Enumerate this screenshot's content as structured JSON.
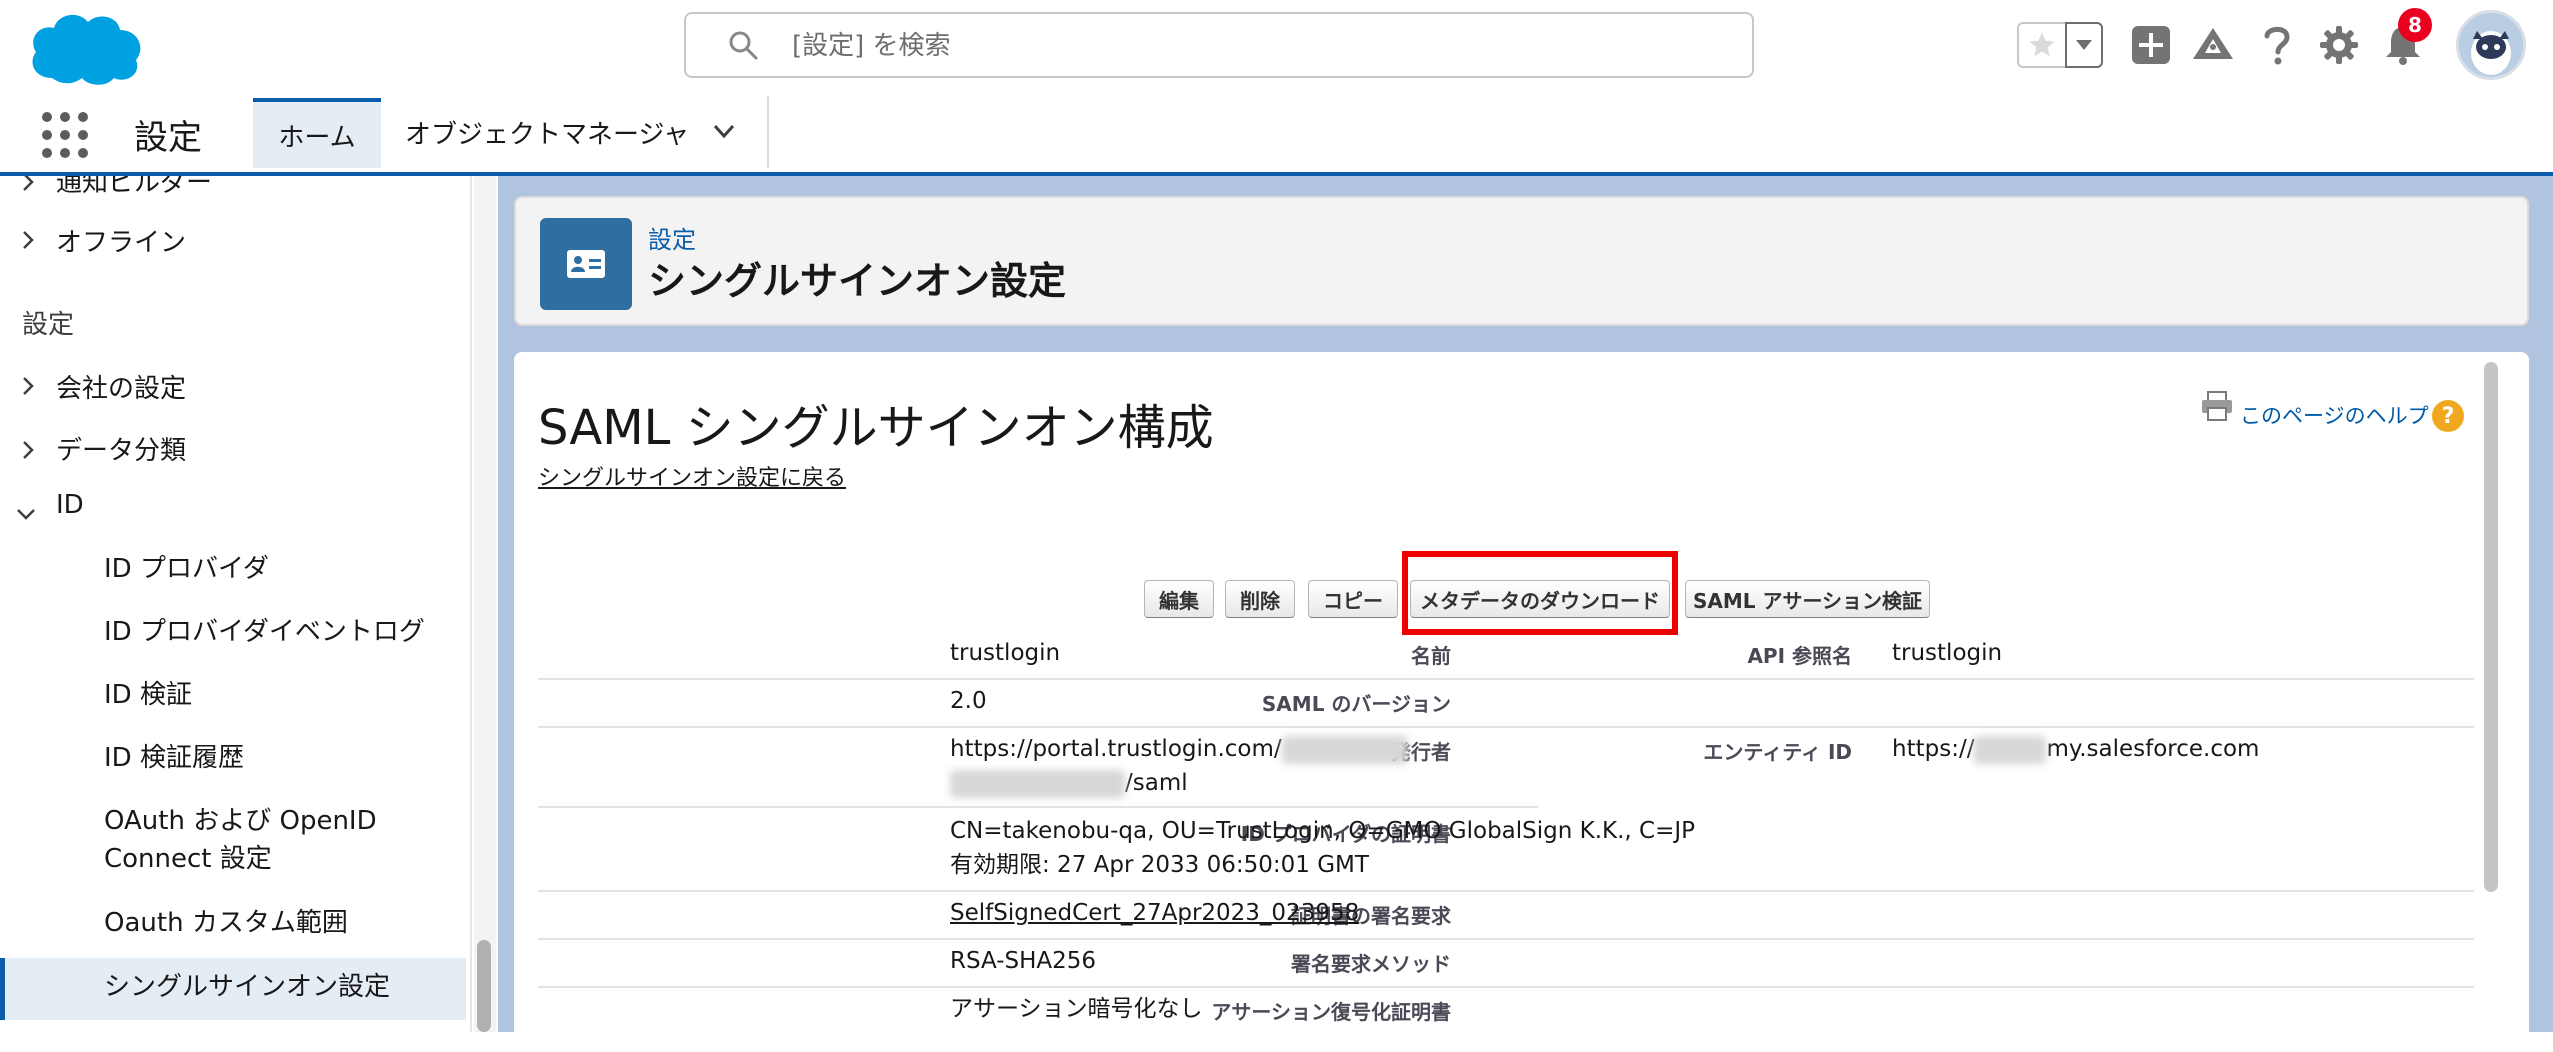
{
  "header": {
    "search_placeholder": "[設定] を検索",
    "notification_count": "8"
  },
  "app_nav": {
    "app_name": "設定",
    "tabs": [
      {
        "label": "ホーム"
      },
      {
        "label": "オブジェクトマネージャ"
      }
    ]
  },
  "sidebar": {
    "items": [
      {
        "label": "通知ビルダー"
      },
      {
        "label": "オフライン"
      }
    ],
    "section_label": "設定",
    "groups": [
      {
        "label": "会社の設定"
      },
      {
        "label": "データ分類"
      },
      {
        "label": "ID"
      }
    ],
    "id_children": [
      {
        "label": "ID プロバイダ"
      },
      {
        "label": "ID プロバイダイベントログ"
      },
      {
        "label": "ID 検証"
      },
      {
        "label": "ID 検証履歴"
      },
      {
        "label": "OAuth および OpenID"
      },
      {
        "label": "Connect 設定"
      },
      {
        "label": "Oauth カスタム範囲"
      },
      {
        "label": "シングルサインオン設定"
      }
    ]
  },
  "page_header": {
    "eyebrow": "設定",
    "title": "シングルサインオン設定"
  },
  "content": {
    "title": "SAML シングルサインオン構成",
    "back_link": "シングルサインオン設定に戻る",
    "help_link": "このページのヘルプ",
    "buttons": {
      "edit": "編集",
      "delete": "削除",
      "copy": "コピー",
      "download_metadata": "メタデータのダウンロード",
      "saml_validator": "SAML アサーション検証"
    },
    "fields": {
      "name_label": "名前",
      "name_value": "trustlogin",
      "api_label": "API 参照名",
      "api_value": "trustlogin",
      "saml_version_label": "SAML のバージョン",
      "saml_version_value": "2.0",
      "issuer_label": "発行者",
      "issuer_value_line1": "https://portal.trustlogin.com/",
      "issuer_value_line2": "/saml",
      "entity_label": "エンティティ ID",
      "entity_prefix": "https://",
      "entity_suffix": "my.salesforce.com",
      "cert_label": "ID プロバイダの証明書",
      "cert_value_line1": "CN=takenobu-qa, OU=TrustLogin, O=GMO GlobalSign K.K., C=JP",
      "cert_value_line2": "有効期限: 27 Apr 2033 06:50:01 GMT",
      "signing_cert_label": "証明書の署名要求",
      "signing_cert_value": "SelfSignedCert_27Apr2023_023958",
      "sign_method_label": "署名要求メソッド",
      "sign_method_value": "RSA-SHA256",
      "assertion_label": "アサーション復号化証明書",
      "assertion_value": "アサーション暗号化なし"
    }
  },
  "colors": {
    "brand_blue": "#0b5cab",
    "salesforce_cloud": "#00a1e0",
    "highlight_red": "#ee0000",
    "badge_red": "#ea001e",
    "help_orange": "#f0a91f"
  },
  "icons": [
    "salesforce-logo",
    "search-icon",
    "star-icon",
    "chevron-down-icon",
    "add-icon",
    "trailhead-icon",
    "help-icon",
    "gear-icon",
    "bell-icon",
    "app-launcher-icon",
    "chevron-right-icon",
    "contact-card-icon",
    "print-icon",
    "help-question-icon"
  ]
}
